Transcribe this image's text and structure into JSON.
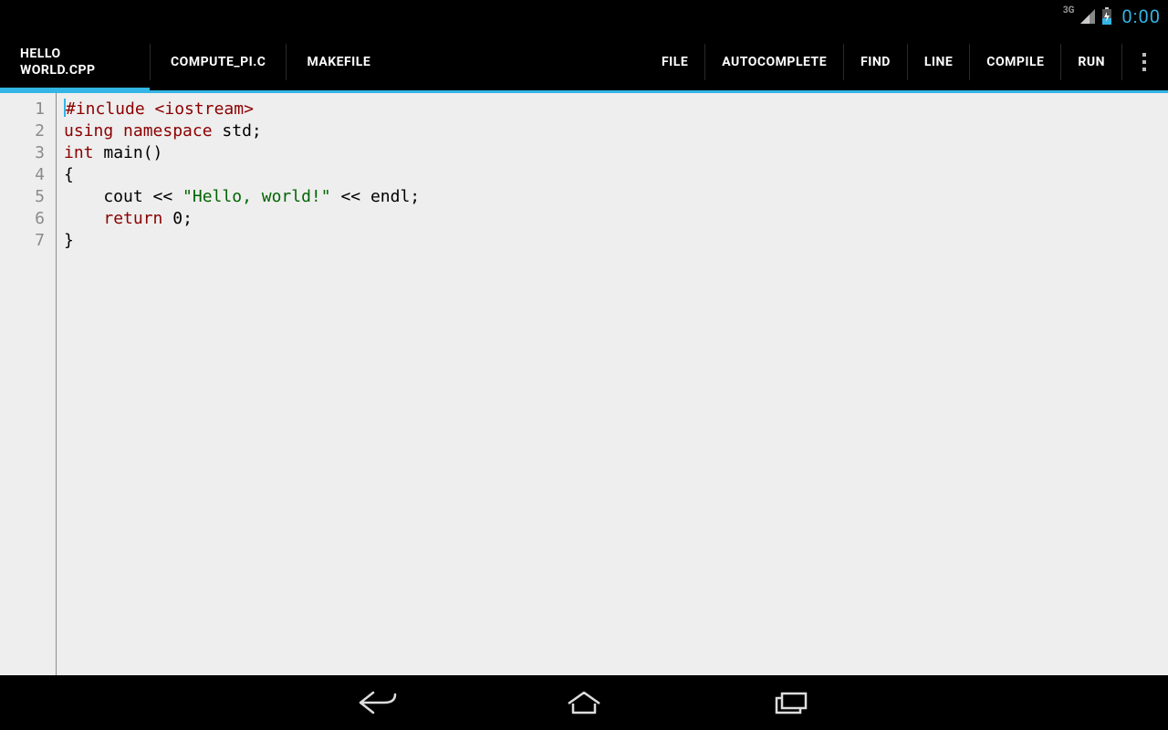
{
  "status": {
    "network_label": "3G",
    "time": "0:00"
  },
  "tabs": [
    {
      "label": "HELLO WORLD.CPP",
      "active": true
    },
    {
      "label": "COMPUTE_PI.C",
      "active": false
    },
    {
      "label": "MAKEFILE",
      "active": false
    }
  ],
  "menus": [
    {
      "key": "file",
      "label": "FILE"
    },
    {
      "key": "autocomplete",
      "label": "AUTOCOMPLETE"
    },
    {
      "key": "find",
      "label": "FIND"
    },
    {
      "key": "line",
      "label": "LINE"
    },
    {
      "key": "compile",
      "label": "COMPILE"
    },
    {
      "key": "run",
      "label": "RUN"
    }
  ],
  "editor": {
    "line_numbers": [
      "1",
      "2",
      "3",
      "4",
      "5",
      "6",
      "7"
    ],
    "lines": [
      {
        "tokens": [
          {
            "t": "cursor"
          },
          {
            "t": "kw",
            "v": "#include "
          },
          {
            "t": "kw",
            "v": "<iostream>"
          }
        ]
      },
      {
        "tokens": [
          {
            "t": "kw",
            "v": "using "
          },
          {
            "t": "kw",
            "v": "namespace "
          },
          {
            "t": "txt",
            "v": "std;"
          }
        ]
      },
      {
        "tokens": [
          {
            "t": "kw",
            "v": "int "
          },
          {
            "t": "txt",
            "v": "main()"
          }
        ]
      },
      {
        "tokens": [
          {
            "t": "txt",
            "v": "{"
          }
        ]
      },
      {
        "tokens": [
          {
            "t": "txt",
            "v": "    cout << "
          },
          {
            "t": "str",
            "v": "\"Hello, world!\""
          },
          {
            "t": "txt",
            "v": " << endl;"
          }
        ]
      },
      {
        "tokens": [
          {
            "t": "txt",
            "v": "    "
          },
          {
            "t": "kw",
            "v": "return "
          },
          {
            "t": "num",
            "v": "0"
          },
          {
            "t": "txt",
            "v": ";"
          }
        ]
      },
      {
        "tokens": [
          {
            "t": "txt",
            "v": "}"
          }
        ]
      }
    ]
  },
  "colors": {
    "accent": "#33b5e5",
    "editor_bg": "#eeeeee",
    "keyword": "#8b0000",
    "string": "#006400"
  }
}
